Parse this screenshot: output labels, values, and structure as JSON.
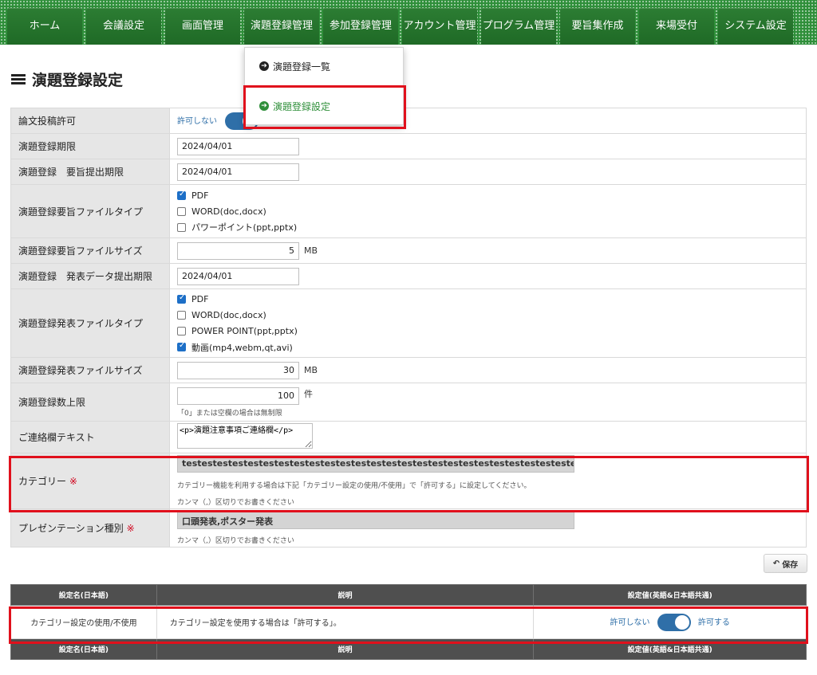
{
  "nav": {
    "items": [
      {
        "label": "ホーム"
      },
      {
        "label": "会議設定"
      },
      {
        "label": "画面管理"
      },
      {
        "label": "演題登録管理"
      },
      {
        "label": "参加登録管理"
      },
      {
        "label": "アカウント管理"
      },
      {
        "label": "プログラム管理"
      },
      {
        "label": "要旨集作成"
      },
      {
        "label": "来場受付"
      },
      {
        "label": "システム設定"
      }
    ]
  },
  "dropdown": {
    "items": [
      {
        "label": "演題登録一覧"
      },
      {
        "label": "演題登録設定"
      }
    ]
  },
  "page": {
    "title": "演題登録設定"
  },
  "form": {
    "paper_permit": {
      "label": "論文投稿許可",
      "off_label": "許可しない"
    },
    "deadline": {
      "label": "演題登録期限",
      "value": "2024/04/01"
    },
    "abstract_deadline": {
      "label": "演題登録　要旨提出期限",
      "value": "2024/04/01"
    },
    "abstract_types": {
      "label": "演題登録要旨ファイルタイプ",
      "options": [
        {
          "label": "PDF",
          "checked": true
        },
        {
          "label": "WORD(doc,docx)",
          "checked": false
        },
        {
          "label": "パワーポイント(ppt,pptx)",
          "checked": false
        }
      ]
    },
    "abstract_size": {
      "label": "演題登録要旨ファイルサイズ",
      "value": "5",
      "unit": "MB"
    },
    "presentation_deadline": {
      "label": "演題登録　発表データ提出期限",
      "value": "2024/04/01"
    },
    "presentation_types": {
      "label": "演題登録発表ファイルタイプ",
      "options": [
        {
          "label": "PDF",
          "checked": true
        },
        {
          "label": "WORD(doc,docx)",
          "checked": false
        },
        {
          "label": "POWER POINT(ppt,pptx)",
          "checked": false
        },
        {
          "label": "動画(mp4,webm,qt,avi)",
          "checked": true
        }
      ]
    },
    "presentation_size": {
      "label": "演題登録発表ファイルサイズ",
      "value": "30",
      "unit": "MB"
    },
    "limit": {
      "label": "演題登録数上限",
      "value": "100",
      "unit": "件",
      "note": "「0」または空欄の場合は無制限"
    },
    "contact": {
      "label": "ご連絡欄テキスト",
      "value": "<p>演題注意事項ご連絡欄</p>"
    },
    "category": {
      "label": "カテゴリー",
      "required_mark": "※",
      "value": "testestestestestestestestestestestestestestestestestestestestestestestestestestestestestestest",
      "note1": "カテゴリー機能を利用する場合は下記「カテゴリー設定の使用/不使用」で「許可する」に設定してください。",
      "note2": "カンマ（,）区切りでお書きください"
    },
    "presentation_kind": {
      "label": "プレゼンテーション種別",
      "required_mark": "※",
      "value": "口頭発表,ポスター発表",
      "note": "カンマ（,）区切りでお書きください"
    }
  },
  "save": {
    "label": "保存"
  },
  "settings": {
    "headers": [
      "設定名(日本語)",
      "説明",
      "設定値(英語&日本語共通)"
    ],
    "row": {
      "name": "カテゴリー設定の使用/不使用",
      "desc": "カテゴリー設定を使用する場合は「許可する」。",
      "off_label": "許可しない",
      "on_label": "許可する"
    }
  },
  "colors": {
    "nav_green": "#2f8f3a",
    "highlight_red": "#e0101c",
    "toggle_blue": "#2f6fa8"
  }
}
